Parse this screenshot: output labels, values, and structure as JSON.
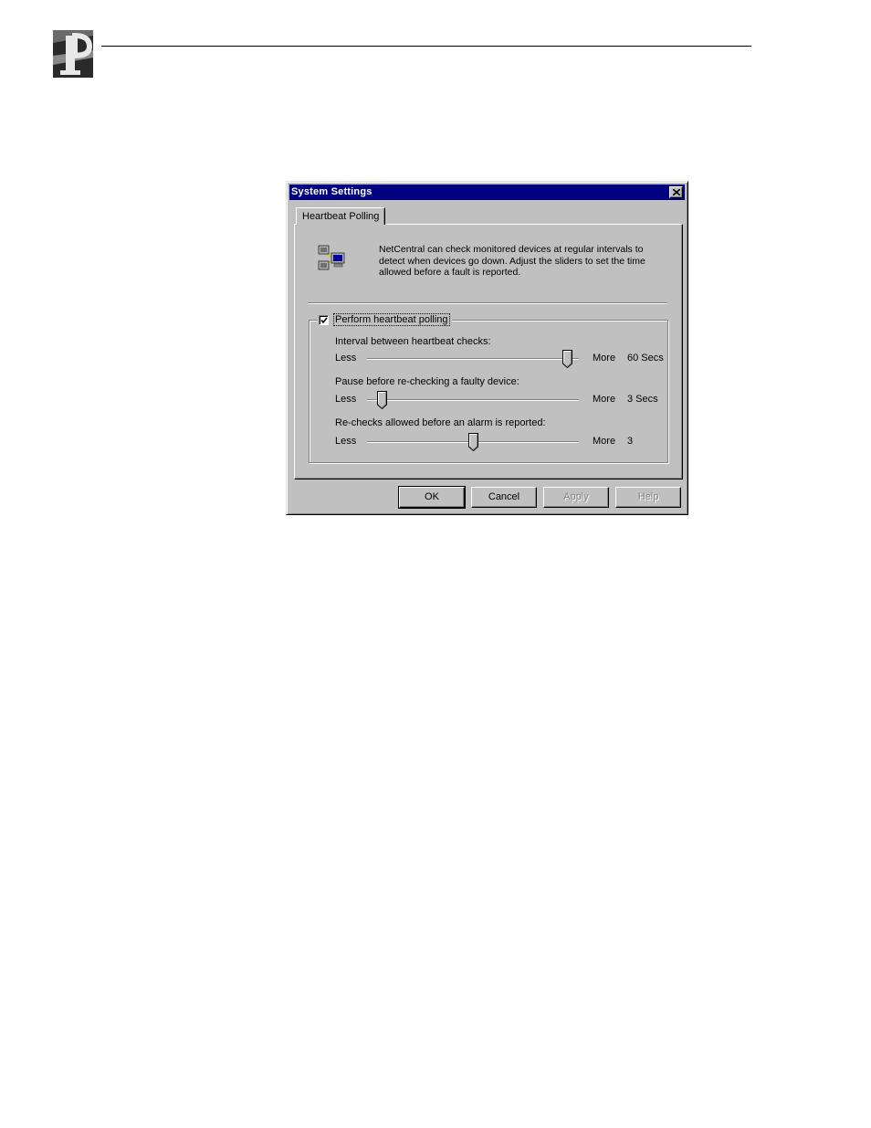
{
  "dialog": {
    "title": "System Settings",
    "tab_label": "Heartbeat Polling",
    "intro_text": "NetCentral can check monitored devices at regular intervals to detect when devices go down. Adjust the sliders to set the time allowed before a fault is reported.",
    "polling_checkbox": {
      "label": "Perform heartbeat polling",
      "checked": true
    },
    "settings": [
      {
        "label": "Interval between heartbeat checks:",
        "less": "Less",
        "more": "More",
        "value": "60 Secs",
        "slider_fraction": 0.97
      },
      {
        "label": "Pause before re-checking a faulty device:",
        "less": "Less",
        "more": "More",
        "value": "3 Secs",
        "slider_fraction": 0.05
      },
      {
        "label": "Re-checks allowed before an alarm is reported:",
        "less": "Less",
        "more": "More",
        "value": "3",
        "slider_fraction": 0.5
      }
    ],
    "buttons": {
      "ok": "OK",
      "cancel": "Cancel",
      "apply": "Apply",
      "help": "Help"
    }
  },
  "colors": {
    "titlebar": "#000080",
    "face": "#c0c0c0",
    "shadow": "#808080",
    "highlight": "#ffffff"
  },
  "icons": [
    "logo-icon",
    "network-computers-icon",
    "close-icon",
    "check-icon"
  ]
}
